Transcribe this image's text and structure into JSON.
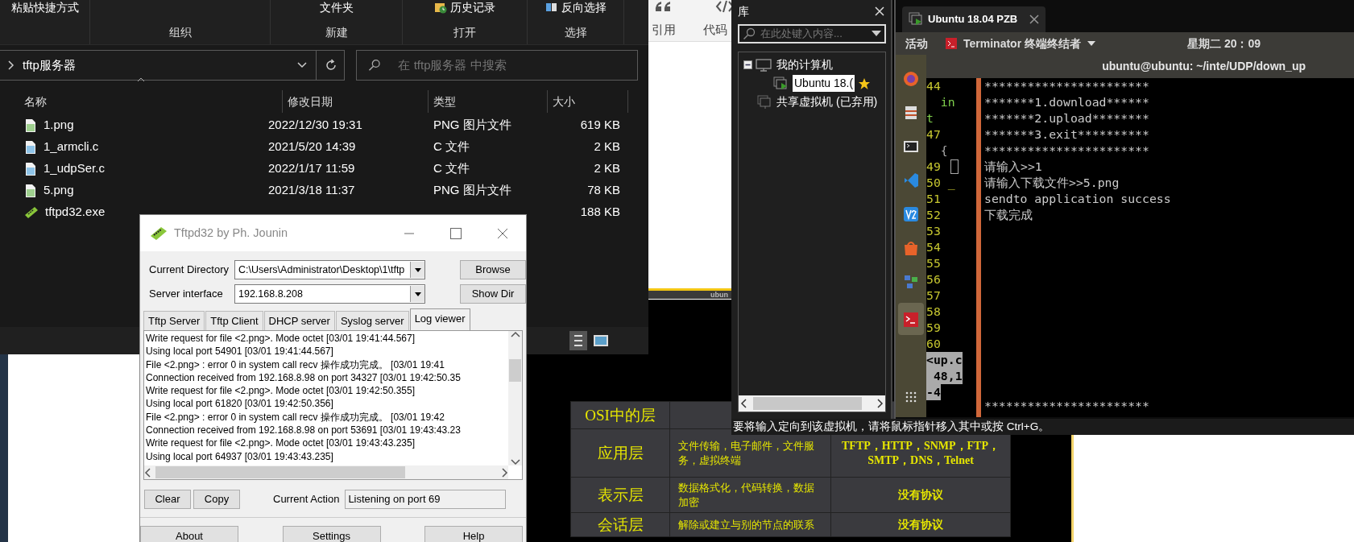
{
  "file_explorer": {
    "ribbon_groups": [
      {
        "items": [
          "粘贴快捷方式"
        ]
      },
      {
        "label": "组织"
      },
      {
        "items": [
          "文件夹"
        ],
        "label": "新建"
      },
      {
        "items": [
          "历史记录"
        ],
        "label": "打开"
      },
      {
        "items": [
          "反向选择"
        ],
        "label": "选择"
      }
    ],
    "address": "tftp服务器",
    "search": {
      "placeholder": "在 tftp服务器 中搜索"
    },
    "columns": [
      "名称",
      "修改日期",
      "类型",
      "大小"
    ],
    "files": [
      {
        "kind": "image",
        "name": "1.png",
        "modified": "2022/12/30 19:31",
        "type": "PNG 图片文件",
        "size": "619 KB"
      },
      {
        "kind": "c",
        "name": "1_armcli.c",
        "modified": "2021/5/20 14:39",
        "type": "C 文件",
        "size": "2 KB"
      },
      {
        "kind": "c",
        "name": "1_udpSer.c",
        "modified": "2022/1/17 11:59",
        "type": "C 文件",
        "size": "2 KB"
      },
      {
        "kind": "image",
        "name": "5.png",
        "modified": "2021/3/18 11:37",
        "type": "PNG 图片文件",
        "size": "78 KB"
      },
      {
        "kind": "exe",
        "name": "tftpd32.exe",
        "size": "188 KB"
      }
    ]
  },
  "editor_toolbar": [
    "引用",
    "代码"
  ],
  "thumbnail_caption": "ubun",
  "vm_library": {
    "title": "库",
    "search": {
      "placeholder": "在此处键入内容..."
    },
    "tree": [
      {
        "label": "我的计算机",
        "expanded": true,
        "selected": false,
        "children": [
          {
            "label": "Ubuntu 18.(",
            "selected": true,
            "favorite": true
          }
        ]
      },
      {
        "label": "共享虚拟机 (已弃用)",
        "selected": false
      }
    ]
  },
  "vm_status_message": "要将输入定向到该虚拟机，请将鼠标指针移入其中或按 Ctrl+G。",
  "vm_tab": {
    "title": "Ubuntu 18.04 PZB"
  },
  "ubuntu_topbar": {
    "activities": "活动",
    "app": "Terminator 终端终结者",
    "clock": "星期二 20：09"
  },
  "terminal": {
    "title": "ubuntu@ubuntu: ~/inte/UDP/down_up",
    "left_pane": [
      {
        "kind": "number",
        "text": "44"
      },
      {
        "kind": "code",
        "text": "  in"
      },
      {
        "kind": "code",
        "text": "t"
      },
      {
        "kind": "number",
        "text": "47"
      },
      {
        "kind": "plain",
        "text": "  {"
      },
      {
        "kind": "number",
        "text": "49",
        "cursor": true
      },
      {
        "kind": "number",
        "text": "50 _"
      },
      {
        "kind": "number",
        "text": "51"
      },
      {
        "kind": "number",
        "text": "52"
      },
      {
        "kind": "number",
        "text": "53"
      },
      {
        "kind": "number",
        "text": "54"
      },
      {
        "kind": "number",
        "text": "55"
      },
      {
        "kind": "number",
        "text": "56"
      },
      {
        "kind": "number",
        "text": "57"
      },
      {
        "kind": "number",
        "text": "58"
      },
      {
        "kind": "number",
        "text": "59"
      },
      {
        "kind": "number",
        "text": "60"
      },
      {
        "kind": "status",
        "text": "<up.c"
      },
      {
        "kind": "status",
        "text": " 48,1"
      },
      {
        "kind": "status",
        "text": "-4"
      }
    ],
    "output": [
      "***********************",
      "*******1.download******",
      "*******2.upload********",
      "*******3.exit**********",
      "***********************",
      "请输入>>1",
      "请输入下载文件>>5.png",
      "sendto application success",
      "下载完成"
    ],
    "last_line": "***********************"
  },
  "tftpd": {
    "title": "Tftpd32 by Ph. Jounin",
    "fields": [
      {
        "label": "Current Directory",
        "value": "C:\\Users\\Administrator\\Desktop\\1\\tftp",
        "button": "Browse"
      },
      {
        "label": "Server interface",
        "value": "192.168.8.208",
        "button": "Show Dir"
      }
    ],
    "tabs": [
      {
        "label": "Tftp Server",
        "selected": false
      },
      {
        "label": "Tftp Client",
        "selected": false
      },
      {
        "label": "DHCP server",
        "selected": false
      },
      {
        "label": "Syslog server",
        "selected": false
      },
      {
        "label": "Log viewer",
        "selected": true
      }
    ],
    "log": [
      "Write request for file <2.png>. Mode octet [03/01 19:41:44.567]",
      "Using local port 54901 [03/01 19:41:44.567]",
      "File <2.png> : error 0 in system call recv 操作成功完成。 [03/01 19:41",
      "Connection received from 192.168.8.98 on port 34327 [03/01 19:42:50.35",
      "Write request for file <2.png>. Mode octet [03/01 19:42:50.355]",
      "Using local port 61820 [03/01 19:42:50.356]",
      "File <2.png> : error 0 in system call recv 操作成功完成。 [03/01 19:42",
      "Connection received from 192.168.8.98 on port 53691 [03/01 19:43:43.23",
      "Write request for file <2.png>. Mode octet [03/01 19:43:43.235]",
      "Using local port 64937 [03/01 19:43:43.235]"
    ],
    "action_buttons": [
      "Clear",
      "Copy"
    ],
    "current_action_label": "Current Action",
    "current_action": "Listening on port 69",
    "bottom_buttons": [
      "About",
      "Settings",
      "Help"
    ]
  },
  "slide_table": {
    "header": "OSI中的层",
    "rows": [
      [
        "应用层",
        "文件传输，电子邮件，文件服务，虚拟终端",
        "TFTP，HTTP，SNMP，FTP，SMTP，DNS，Telnet"
      ],
      [
        "表示层",
        "数据格式化，代码转换，数据加密",
        "没有协议"
      ],
      [
        "会话层",
        "解除或建立与别的节点的联系",
        "没有协议"
      ]
    ]
  }
}
